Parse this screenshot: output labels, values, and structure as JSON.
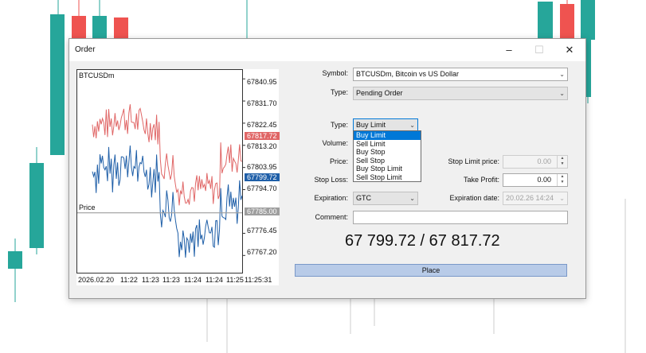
{
  "dialog": {
    "title": "Order",
    "minimize": "–",
    "maximize": "☐",
    "close": "✕"
  },
  "chart": {
    "symbol": "BTCUSDm",
    "price_line_label": "Price",
    "price_ticks": [
      "67840.95",
      "67831.70",
      "67822.45",
      "67813.20",
      "67803.95",
      "67794.70",
      "67776.45",
      "67767.20"
    ],
    "ask_badge": "67817.72",
    "bid_badge": "67799.72",
    "line_badge": "67785.00",
    "time_ticks": [
      "2026.02.20",
      "11:22",
      "11:23",
      "11:23",
      "11:24",
      "11:24",
      "11:25",
      "11:25:31"
    ],
    "colors": {
      "ask": "#e06666",
      "bid": "#1f5fa8",
      "line": "#9e9e9e"
    }
  },
  "form": {
    "symbol_label": "Symbol:",
    "symbol_value": "BTCUSDm, Bitcoin vs US Dollar",
    "type_label": "Type:",
    "type_value": "Pending Order",
    "order_type_label": "Type:",
    "order_type_value": "Buy Limit",
    "order_type_options": [
      "Buy Limit",
      "Sell Limit",
      "Buy Stop",
      "Sell Stop",
      "Buy Stop Limit",
      "Sell Stop Limit"
    ],
    "volume_label": "Volume:",
    "price_label": "Price:",
    "stop_loss_label": "Stop Loss:",
    "stop_limit_label": "Stop Limit price:",
    "stop_limit_value": "0.00",
    "take_profit_label": "Take Profit:",
    "take_profit_value": "0.00",
    "expiration_label": "Expiration:",
    "expiration_value": "GTC",
    "expiration_date_label": "Expiration date:",
    "expiration_date_value": "20.02.26 14:24",
    "comment_label": "Comment:",
    "comment_value": "",
    "bid_ask_display": "67 799.72 / 67 817.72",
    "place_label": "Place"
  }
}
